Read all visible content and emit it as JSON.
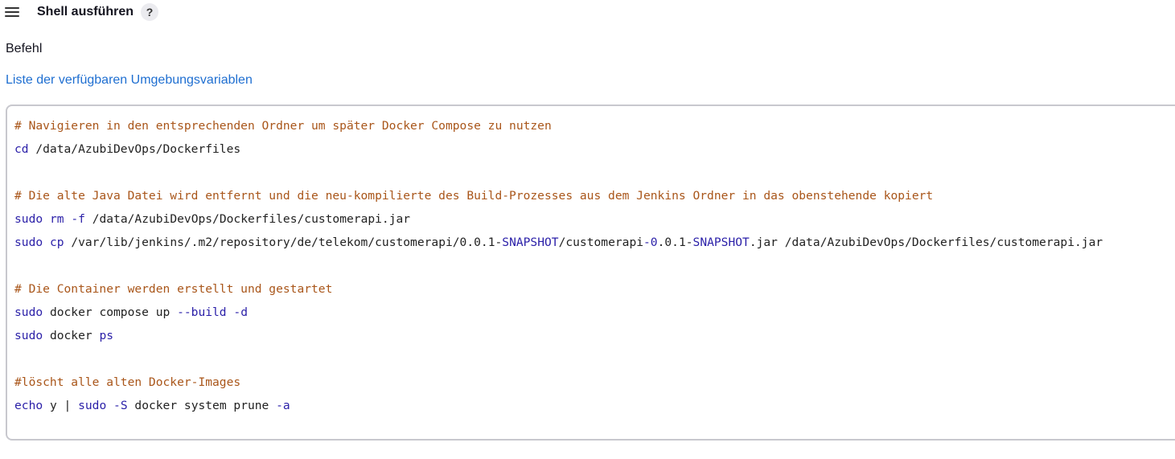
{
  "header": {
    "title": "Shell ausführen",
    "help_label": "?"
  },
  "field": {
    "label": "Befehl",
    "env_link": "Liste der verfügbaren Umgebungsvariablen"
  },
  "editor": {
    "l1": "# Navigieren in den entsprechenden Ordner um später Docker Compose zu nutzen",
    "l2a": "cd",
    "l2b": " /data/AzubiDevOps/Dockerfiles",
    "l4": "# Die alte Java Datei wird entfernt und die neu-kompilierte des Build-Prozesses aus dem Jenkins Ordner in das obenstehende kopiert",
    "l5a": "sudo",
    "l5b": " ",
    "l5c": "rm",
    "l5d": " ",
    "l5e": "-f",
    "l5f": " /data/AzubiDevOps/Dockerfiles/customerapi.jar",
    "l6a": "sudo",
    "l6b": " ",
    "l6c": "cp",
    "l6d": " /var/lib/jenkins/.m2/repository/de/telekom/customerapi/0.0.1-",
    "l6e": "SNAPSHOT",
    "l6f": "/customerapi",
    "l6g": "-0",
    "l6h": ".0.1-",
    "l6i": "SNAPSHOT",
    "l6j": ".jar /data/AzubiDevOps/Dockerfiles/customerapi.jar",
    "l8": "# Die Container werden erstellt und gestartet",
    "l9a": "sudo",
    "l9b": " docker compose up ",
    "l9c": "--build",
    "l9d": " ",
    "l9e": "-d",
    "l10a": "sudo",
    "l10b": " docker ",
    "l10c": "ps",
    "l12": "#löscht alle alten Docker-Images",
    "l13a": "echo",
    "l13b": " y | ",
    "l13c": "sudo",
    "l13d": " ",
    "l13e": "-S",
    "l13f": " docker system prune ",
    "l13g": "-a"
  }
}
